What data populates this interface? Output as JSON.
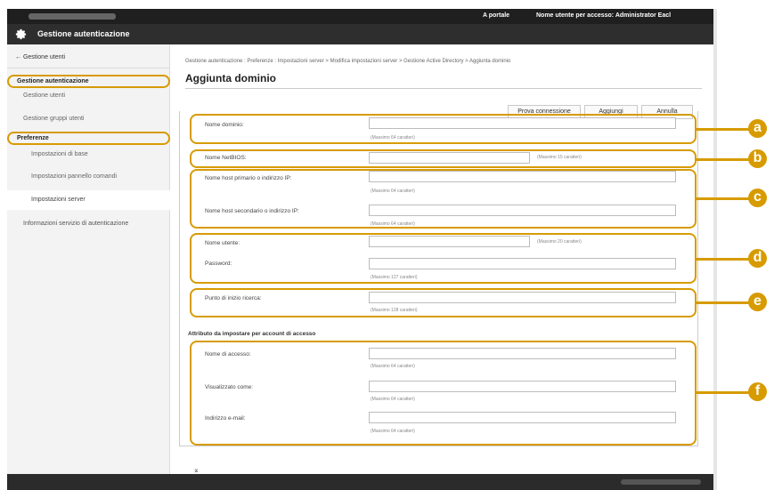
{
  "topbar": {
    "portal_link": "A portale",
    "user_label": "Nome utente per accesso: Administrator Eacl"
  },
  "titlebar": {
    "title": "Gestione autenticazione",
    "icon": "gear-icon"
  },
  "sidebar": {
    "back_link": "← Gestione utenti",
    "items": [
      {
        "label": "Gestione autenticazione",
        "kind": "group"
      },
      {
        "label": "Gestione utenti",
        "kind": "l2"
      },
      {
        "label": "Gestione gruppi utenti",
        "kind": "l2"
      },
      {
        "label": "Preferenze",
        "kind": "group"
      },
      {
        "label": "Impostazioni di base",
        "kind": "l3"
      },
      {
        "label": "Impostazioni pannello comandi",
        "kind": "l3"
      },
      {
        "label": "Impostazioni server",
        "kind": "l3",
        "selected": true
      },
      {
        "label": "Informazioni servizio di autenticazione",
        "kind": "l2"
      }
    ]
  },
  "main": {
    "breadcrumb": "Gestione autenticazione : Preferenze : Impostazioni server > Modifica impostazioni server > Gestione Active Directory > Aggiunta dominio",
    "title": "Aggiunta dominio",
    "buttons": {
      "test_connection": "Prova connessione",
      "add": "Aggiungi",
      "cancel": "Annulla"
    },
    "fields": {
      "domain_name": {
        "label": "Nome dominio:",
        "hint": "(Massimo 64 caratteri)",
        "value": ""
      },
      "netbios_name": {
        "label": "Nome NetBIOS:",
        "hint": "(Massimo 15 caratteri)",
        "value": ""
      },
      "primary_host": {
        "label": "Nome host primario o indirizzo IP:",
        "hint": "(Massimo 64 caratteri)",
        "value": ""
      },
      "secondary_host": {
        "label": "Nome host secondario o indirizzo IP:",
        "hint": "(Massimo 64 caratteri)",
        "value": ""
      },
      "username": {
        "label": "Nome utente:",
        "hint": "(Massimo 20 caratteri)",
        "value": ""
      },
      "password": {
        "label": "Password:",
        "hint": "(Massimo 127 caratteri)",
        "value": ""
      },
      "search_start": {
        "label": "Punto di inizio ricerca:",
        "hint": "(Massimo 128 caratteri)",
        "value": ""
      },
      "login_name": {
        "label": "Nome di accesso:",
        "hint": "(Massimo 64 caratteri)",
        "value": ""
      },
      "display_as": {
        "label": "Visualizzato come:",
        "hint": "(Massimo 64 caratteri)",
        "value": ""
      },
      "email": {
        "label": "Indirizzo e-mail:",
        "hint": "(Massimo 64 caratteri)",
        "value": ""
      }
    },
    "attributes_heading": "Attributo da impostare per account di accesso",
    "top_link": "⌅"
  },
  "callouts": [
    "a",
    "b",
    "c",
    "d",
    "e",
    "f"
  ],
  "colors": {
    "callout": "#d79b00",
    "header_dark": "#1f1f1f",
    "sidebar_bg": "#f3f3f3"
  }
}
